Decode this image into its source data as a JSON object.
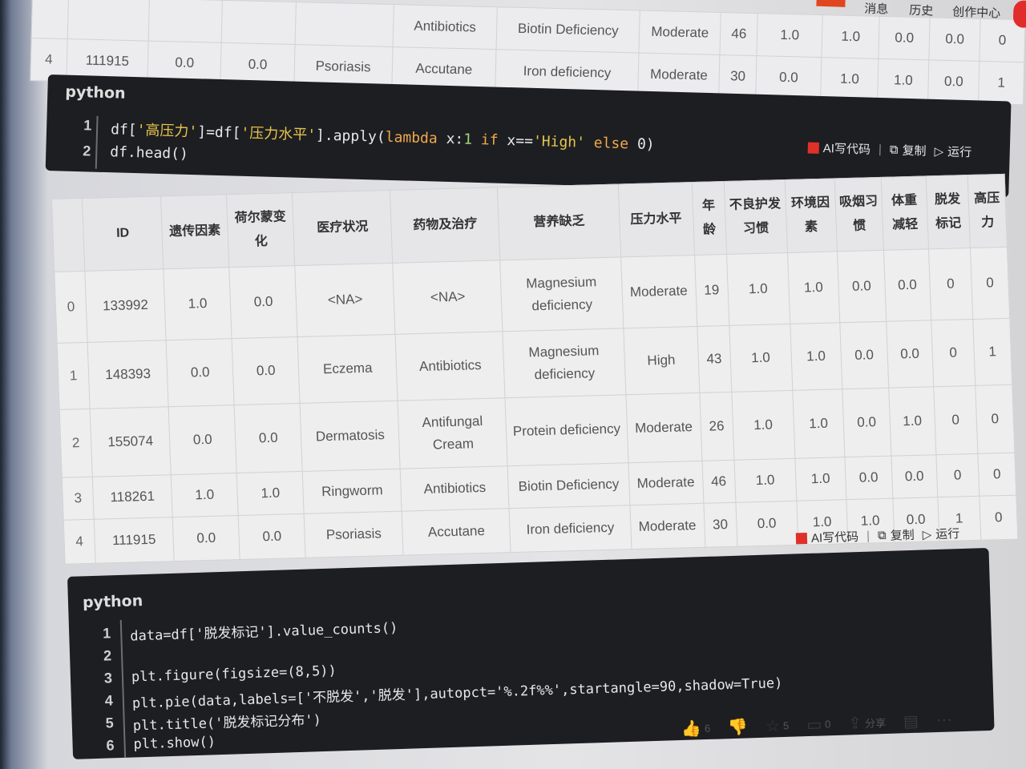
{
  "nav": {
    "items": [
      "消息",
      "历史",
      "创作中心"
    ]
  },
  "top_table": {
    "rows": [
      [
        "4",
        "111915",
        "0.0",
        "0.0",
        "Psoriasis",
        "Accutane",
        "Iron deficiency",
        "Moderate",
        "30",
        "0.0",
        "1.0",
        "1.0",
        "0.0",
        "1"
      ]
    ],
    "row3": [
      "",
      "",
      "",
      "",
      "",
      "Antibiotics",
      "Biotin Deficiency",
      "Moderate",
      "46",
      "1.0",
      "1.0",
      "0.0",
      "0.0",
      "0"
    ]
  },
  "code1": {
    "lang": "python",
    "line_numbers": [
      "1",
      "2"
    ],
    "lines": [
      "df['高压力']=df['压力水平'].apply(lambda x:1 if x=='High' else 0)",
      "df.head()"
    ],
    "toolbar": {
      "ai": "AI写代码",
      "copy": "复制",
      "run": "运行"
    }
  },
  "table": {
    "headers": [
      "",
      "ID",
      "遗传因素",
      "荷尔蒙变化",
      "医疗状况",
      "药物及治疗",
      "营养缺乏",
      "压力水平",
      "年龄",
      "不良护发习惯",
      "环境因素",
      "吸烟习惯",
      "体重减轻",
      "脱发标记",
      "高压力"
    ],
    "rows": [
      [
        "0",
        "133992",
        "1.0",
        "0.0",
        "<NA>",
        "<NA>",
        "Magnesium deficiency",
        "Moderate",
        "19",
        "1.0",
        "1.0",
        "0.0",
        "0.0",
        "0",
        "0"
      ],
      [
        "1",
        "148393",
        "0.0",
        "0.0",
        "Eczema",
        "Antibiotics",
        "Magnesium deficiency",
        "High",
        "43",
        "1.0",
        "1.0",
        "0.0",
        "0.0",
        "0",
        "1"
      ],
      [
        "2",
        "155074",
        "0.0",
        "0.0",
        "Dermatosis",
        "Antifungal Cream",
        "Protein deficiency",
        "Moderate",
        "26",
        "1.0",
        "1.0",
        "0.0",
        "1.0",
        "0",
        "0"
      ],
      [
        "3",
        "118261",
        "1.0",
        "1.0",
        "Ringworm",
        "Antibiotics",
        "Biotin Deficiency",
        "Moderate",
        "46",
        "1.0",
        "1.0",
        "0.0",
        "0.0",
        "0",
        "0"
      ],
      [
        "4",
        "111915",
        "0.0",
        "0.0",
        "Psoriasis",
        "Accutane",
        "Iron deficiency",
        "Moderate",
        "30",
        "0.0",
        "1.0",
        "1.0",
        "0.0",
        "1",
        "0"
      ]
    ]
  },
  "code2": {
    "lang": "python",
    "line_numbers": [
      "1",
      "2",
      "3",
      "4",
      "5",
      "6"
    ],
    "lines": [
      "data=df['脱发标记'].value_counts()",
      "",
      "plt.figure(figsize=(8,5))",
      "plt.pie(data,labels=['不脱发','脱发'],autopct='%.2f%%',startangle=90,shadow=True)",
      "plt.title('脱发标记分布')",
      "plt.show()"
    ],
    "toolbar": {
      "ai": "AI写代码",
      "copy": "复制",
      "run": "运行"
    }
  },
  "bottombar": {
    "like_count": "6",
    "star_count": "5",
    "comment_count": "0",
    "share_label": "分享"
  }
}
